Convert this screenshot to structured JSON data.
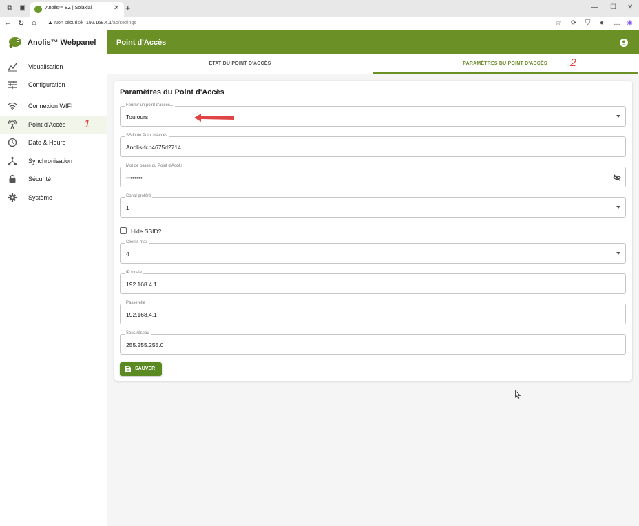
{
  "browser": {
    "tab_title": "Anolis™ EZ | Solaxial",
    "tab_close": "✕",
    "new_tab": "+",
    "security_label": "Non sécurisé",
    "url_host": "192.168.4.1",
    "url_path": "/ap/settings",
    "window_controls": [
      "—",
      "☐",
      "✕"
    ]
  },
  "sidebar": {
    "brand": "Anolis™ Webpanel",
    "items": [
      {
        "label": "Visualisation",
        "icon": "chart-icon"
      },
      {
        "label": "Configuration",
        "icon": "sliders-icon"
      },
      {
        "label": "Connexion WIFI",
        "icon": "wifi-icon"
      },
      {
        "label": "Point d'Accès",
        "icon": "access-point-icon"
      },
      {
        "label": "Date & Heure",
        "icon": "clock-icon"
      },
      {
        "label": "Synchronisation",
        "icon": "sync-icon"
      },
      {
        "label": "Sécurité",
        "icon": "lock-icon"
      },
      {
        "label": "Système",
        "icon": "gear-icon"
      }
    ],
    "active_index": 3
  },
  "annotations": {
    "one": "1",
    "two": "2"
  },
  "appbar": {
    "title": "Point d'Accès"
  },
  "tabs": [
    {
      "label": "ÉTAT DU POINT D'ACCÈS",
      "active": false
    },
    {
      "label": "PARAMÈTRES DU POINT D'ACCÈS",
      "active": true
    }
  ],
  "form": {
    "title": "Paramètres du Point d'Accès",
    "provide_ap": {
      "label": "Fournir un point d'accès...",
      "value": "Toujours"
    },
    "ssid": {
      "label": "SSID du Point d'Accès",
      "value": "Anolis-fcb4675d2714"
    },
    "password": {
      "label": "Mot de passe du Point d'Accès",
      "value": "••••••••"
    },
    "channel": {
      "label": "Canal préféré",
      "value": "1"
    },
    "hide_ssid": {
      "label": "Hide SSID?",
      "checked": false
    },
    "max_clients": {
      "label": "Clients max",
      "value": "4"
    },
    "local_ip": {
      "label": "IP locale",
      "value": "192.168.4.1"
    },
    "gateway": {
      "label": "Passerelle",
      "value": "192.168.4.1"
    },
    "subnet": {
      "label": "Sous réseau",
      "value": "255.255.255.0"
    },
    "save_label": "SAUVER"
  },
  "colors": {
    "primary": "#6b9026",
    "active_tab_text": "#6b8a2a",
    "annotation": "#e04040"
  }
}
